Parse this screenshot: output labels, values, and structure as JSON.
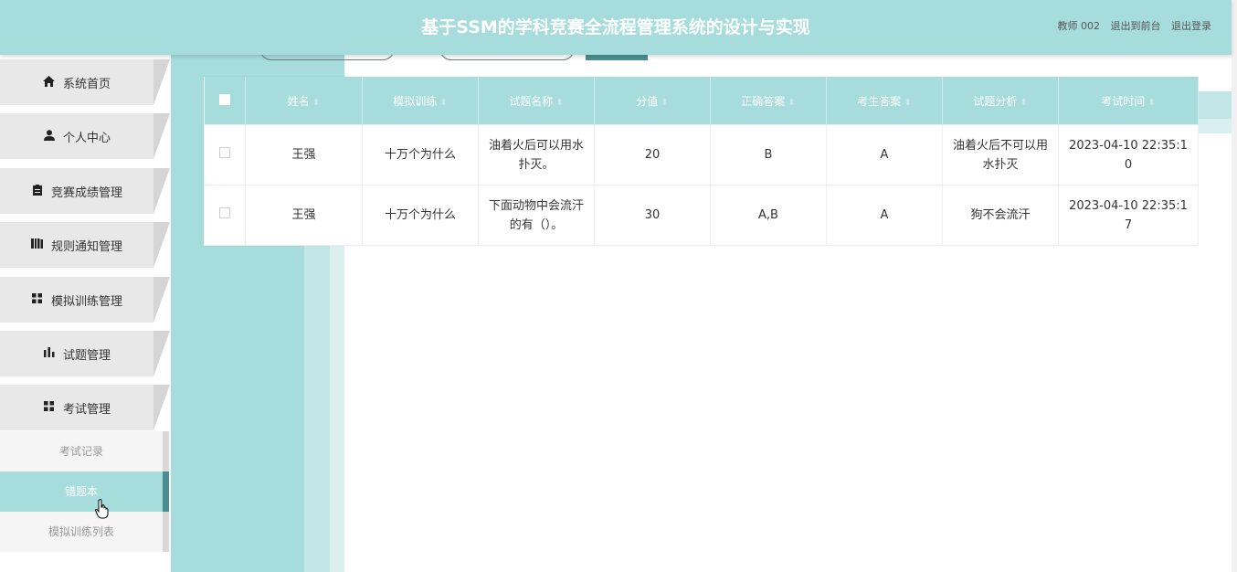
{
  "header": {
    "title": "基于SSM的学科竞赛全流程管理系统的设计与实现",
    "user": "教师 002",
    "back_front": "退出到前台",
    "logout": "退出登录"
  },
  "sidebar": {
    "items": [
      {
        "label": "系统首页",
        "icon": "home-icon"
      },
      {
        "label": "个人中心",
        "icon": "user-icon"
      },
      {
        "label": "竞赛成绩管理",
        "icon": "clipboard-icon"
      },
      {
        "label": "规则通知管理",
        "icon": "book-icon"
      },
      {
        "label": "模拟训练管理",
        "icon": "grid-icon"
      },
      {
        "label": "试题管理",
        "icon": "bar-chart-icon"
      },
      {
        "label": "考试管理",
        "icon": "grid-icon"
      }
    ],
    "sub_items": [
      {
        "label": "考试记录",
        "active": false
      },
      {
        "label": "错题本",
        "active": true
      },
      {
        "label": "模拟训练列表",
        "active": false
      }
    ]
  },
  "table": {
    "columns": [
      "姓名",
      "模拟训练",
      "试题名称",
      "分值",
      "正确答案",
      "考生答案",
      "试题分析",
      "考试时间"
    ],
    "rows": [
      [
        "王强",
        "十万个为什么",
        "油着火后可以用水扑灭。",
        "20",
        "B",
        "A",
        "油着火后不可以用水扑灭",
        "2023-04-10 22:35:10"
      ],
      [
        "王强",
        "十万个为什么",
        "下面动物中会流汗的有（）。",
        "30",
        "A,B",
        "A",
        "狗不会流汗",
        "2023-04-10 22:35:17"
      ]
    ]
  },
  "colors": {
    "accent": "#a6dcdc",
    "accent_dark": "#4a8f8f"
  }
}
